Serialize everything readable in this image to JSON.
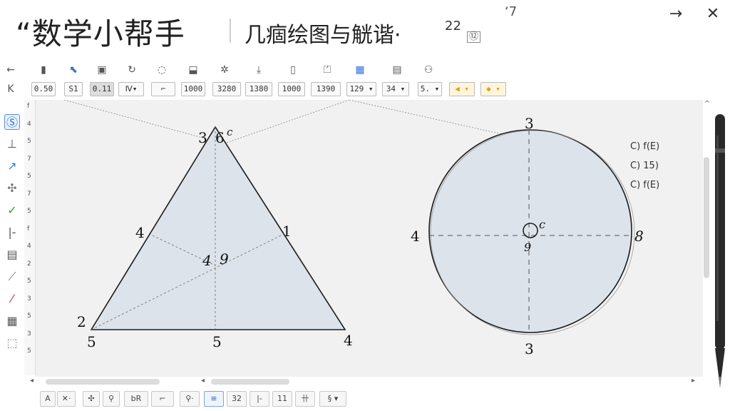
{
  "window": {
    "app_title": "“数学小帮手",
    "doc_title": "几痼绘图与觥谐·",
    "doc_sup": "22",
    "doc_badge": "⑫",
    "extra_mark": "‘7",
    "forward_glyph": "→",
    "close_glyph": "✕"
  },
  "toolbar1": {
    "back_glyph": "←",
    "icons": [
      "page-icon",
      "select-icon",
      "image-icon",
      "rotate-icon",
      "circle-select-icon",
      "move-icon",
      "gear-icon",
      "export-icon",
      "file-icon",
      "filter-icon",
      "color-icon",
      "print-icon",
      "link-icon"
    ],
    "glyphs": [
      "▮",
      "⬉",
      "▣",
      "↻",
      "◌",
      "⬓",
      "✲",
      "⤓",
      "▯",
      "⏍",
      "▦",
      "▤",
      "⚇"
    ]
  },
  "toolbar2": {
    "cursor_glyph": "K",
    "fields": [
      "0.50",
      "S1",
      "0.11",
      "Ⅳ▾",
      "⌐",
      "1000",
      "3280",
      "1380",
      "1000",
      "1390",
      "129 ▾",
      "34 ▾",
      "5. ▾",
      "◀ ▾",
      "◆ ▾"
    ]
  },
  "palette": {
    "glyphs": [
      "Ⓢ",
      "⊥",
      "↗",
      "✣",
      "✓",
      "|-",
      "▤",
      "⟋",
      "⁄",
      "▦",
      "⬚"
    ]
  },
  "ruler_labels": [
    "f",
    "4",
    "5",
    "7",
    "5",
    "7",
    "5",
    "f",
    "4",
    "2",
    "5",
    "3",
    "5",
    "3",
    "5"
  ],
  "legend": [
    "C) f(E)",
    "C) 15)",
    "C) f(E)"
  ],
  "triangle": {
    "top_labels": [
      "3",
      "6"
    ],
    "top_sup": "c",
    "left_mid": "4",
    "right_mid": "1",
    "center": "4",
    "center_sup": "9",
    "bottom_left_a": "2",
    "bottom_left_b": "5",
    "bottom_mid": "5",
    "bottom_right": "4"
  },
  "circle": {
    "top": "3",
    "left": "4",
    "right": "8",
    "bottom": "3",
    "center_label": "c",
    "center_sub": "9"
  },
  "bottom_toolbar": {
    "buttons": [
      "A",
      "✕·",
      "✣",
      "⚲",
      "bR",
      "⌐",
      "⚲·",
      "≡",
      "32",
      "|-",
      "11",
      "卄",
      "§ ▾"
    ]
  },
  "scroll": {
    "up": "^",
    "left": "◂",
    "right": "▸",
    "mid": "◂"
  }
}
